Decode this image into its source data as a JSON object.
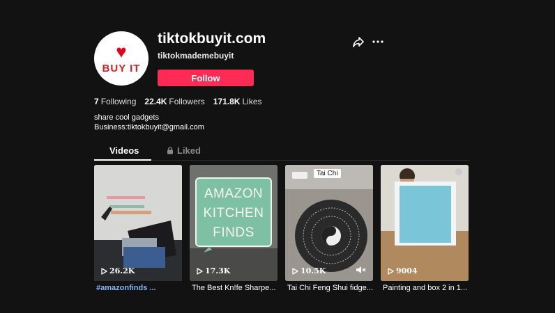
{
  "profile": {
    "avatar_text": "BUY IT",
    "title": "tiktokbuyit.com",
    "username": "tiktokmademebuyit",
    "follow_label": "Follow"
  },
  "stats": {
    "following_count": "7",
    "following_label": "Following",
    "followers_count": "22.4K",
    "followers_label": "Followers",
    "likes_count": "171.8K",
    "likes_label": "Likes"
  },
  "bio": {
    "line1": "share cool gadgets",
    "line2": "Business:tiktokbuyit@gmail.com"
  },
  "tabs": {
    "videos": "Videos",
    "liked": "Liked"
  },
  "videos": [
    {
      "views": "26.2K",
      "caption": "#amazonfinds ..."
    },
    {
      "views": "17.3K",
      "caption": "The Best Kn!fe Sharpe...",
      "overlay": "AMAZON KITCHEN FINDS"
    },
    {
      "views": "10.5K",
      "caption": "Tai Chi Feng Shui fidge...",
      "label": "Tai Chi"
    },
    {
      "views": "9004",
      "caption": "Painting and box 2 in 1..."
    }
  ],
  "colors": {
    "background": "#121212",
    "follow_button": "#fe2c55",
    "hashtag": "#8ab4f8"
  }
}
